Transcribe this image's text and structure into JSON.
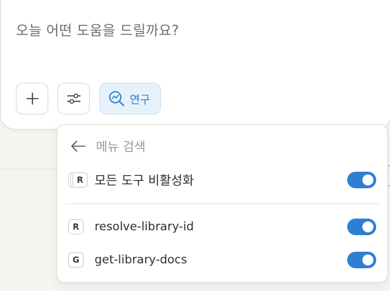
{
  "composer": {
    "placeholder": "오늘 어떤 도움을 드릴까요?",
    "buttons": {
      "add_icon": "plus-icon",
      "settings_icon": "sliders-icon",
      "research_icon": "research-icon",
      "research_label": "연구"
    }
  },
  "menu": {
    "search_placeholder": "메뉴 검색",
    "back_icon": "arrow-left-icon",
    "toggle_all": {
      "badge": "R",
      "label": "모든 도구 비활성화",
      "enabled": true
    },
    "tools": [
      {
        "badge": "R",
        "name": "resolve-library-id",
        "enabled": true
      },
      {
        "badge": "G",
        "name": "get-library-docs",
        "enabled": true
      }
    ]
  },
  "colors": {
    "accent": "#2d7fd1",
    "research_bg": "#e7f1fb",
    "research_text": "#2c7fce"
  }
}
